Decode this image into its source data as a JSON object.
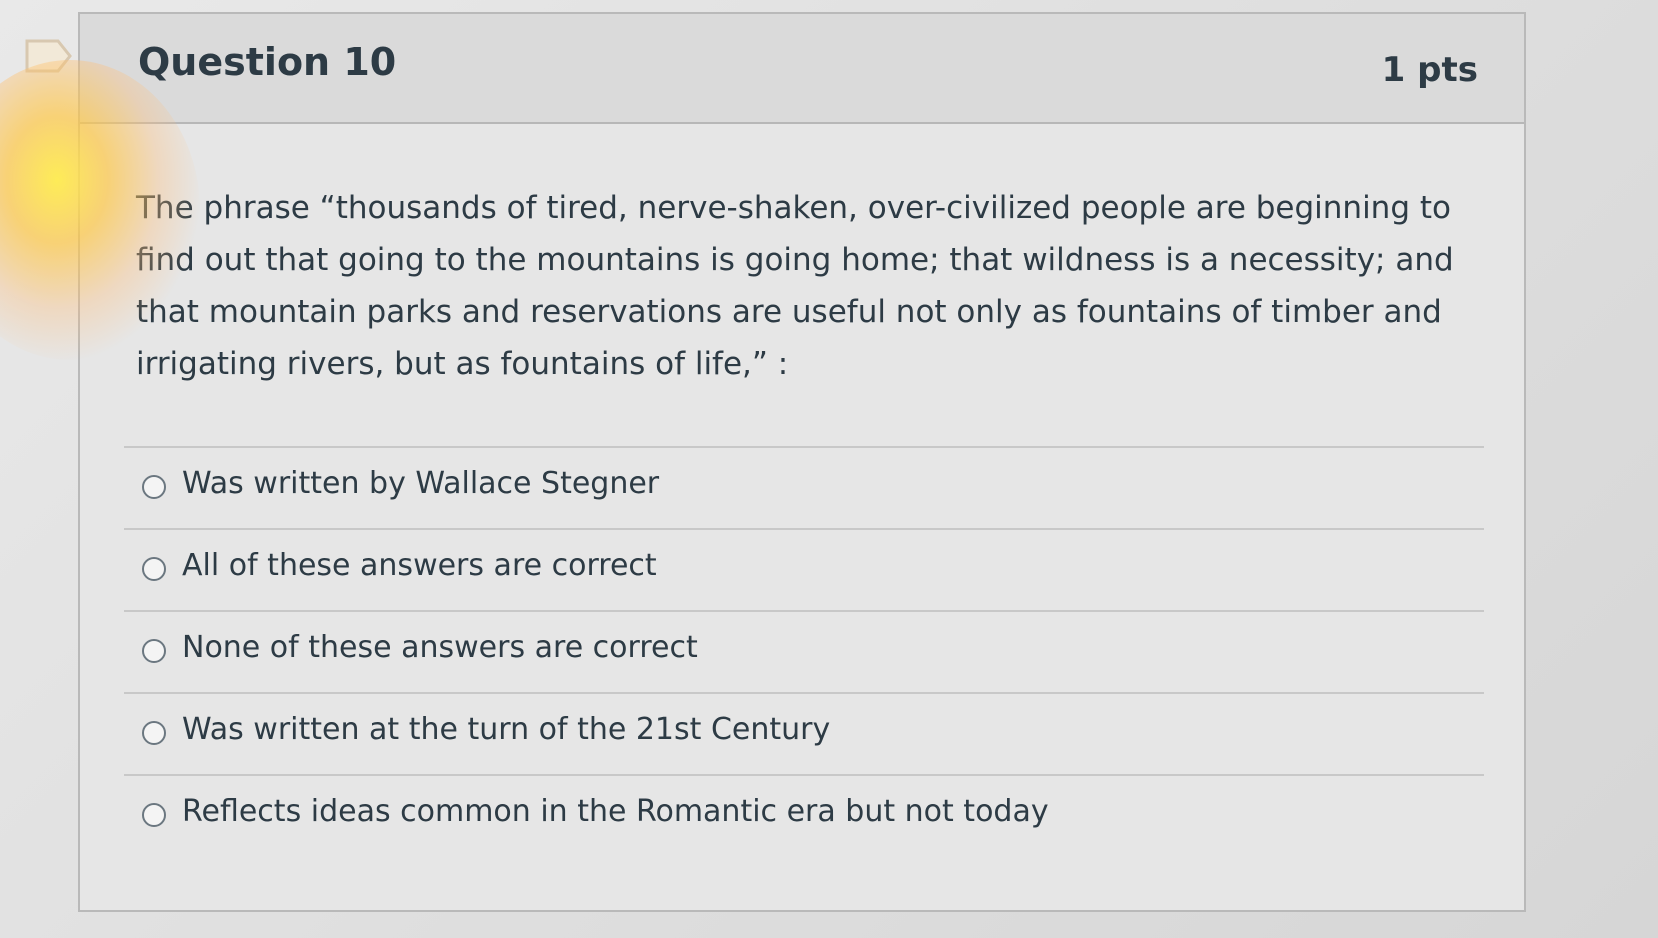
{
  "question": {
    "title": "Question 10",
    "points": "1 pts",
    "text": "The phrase “thousands of tired, nerve-shaken, over-civilized people are beginning to find out that going to the mountains is going home; that wildness is a necessity; and that mountain parks and reservations are useful not only as fountains of timber and irrigating rivers, but as fountains of life,” :",
    "flag_icon": "bookmark-flag-icon"
  },
  "answers": [
    {
      "label": "Was written by Wallace Stegner"
    },
    {
      "label": "All of these answers are correct"
    },
    {
      "label": "None of these answers are correct"
    },
    {
      "label": "Was written at the turn of the 21st Century"
    },
    {
      "label": "Reflects ideas common in the Romantic era but not today"
    }
  ],
  "colors": {
    "text": "#2d3b45",
    "card_background": "#e6e6e6",
    "header_background": "#dadada",
    "border": "#b9b9b9"
  }
}
